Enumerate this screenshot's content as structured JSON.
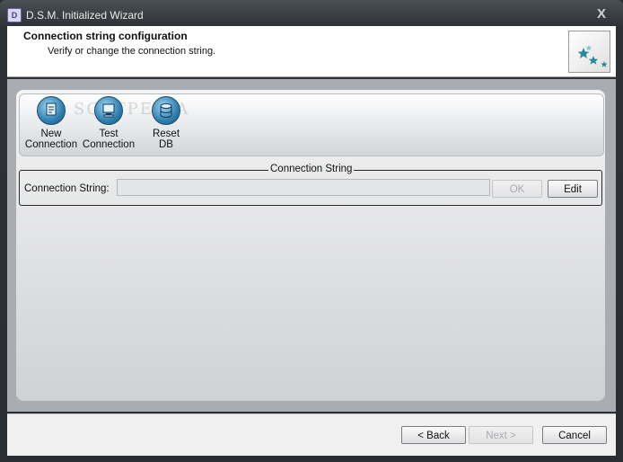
{
  "window": {
    "title": "D.S.M. Initialized Wizard",
    "close_label": "X"
  },
  "header": {
    "title": "Connection string configuration",
    "subtitle": "Verify or change the connection string."
  },
  "toolbar": {
    "watermark": "SOFTPEDIA",
    "buttons": [
      {
        "line1": "New",
        "line2": "Connection",
        "icon": "new-connection-icon"
      },
      {
        "line1": "Test",
        "line2": "Connection",
        "icon": "test-connection-icon"
      },
      {
        "line1": "Reset",
        "line2": "DB",
        "icon": "reset-db-icon"
      }
    ]
  },
  "connection": {
    "group_title": "Connection String",
    "label": "Connection String:",
    "value": "",
    "ok_label": "OK",
    "edit_label": "Edit"
  },
  "footer": {
    "back_label": "< Back",
    "next_label": "Next >",
    "cancel_label": "Cancel"
  },
  "colors": {
    "accent_icon": "#2f7fb1",
    "window_frame": "#2e3236",
    "logo_star": "#1f8a99"
  }
}
